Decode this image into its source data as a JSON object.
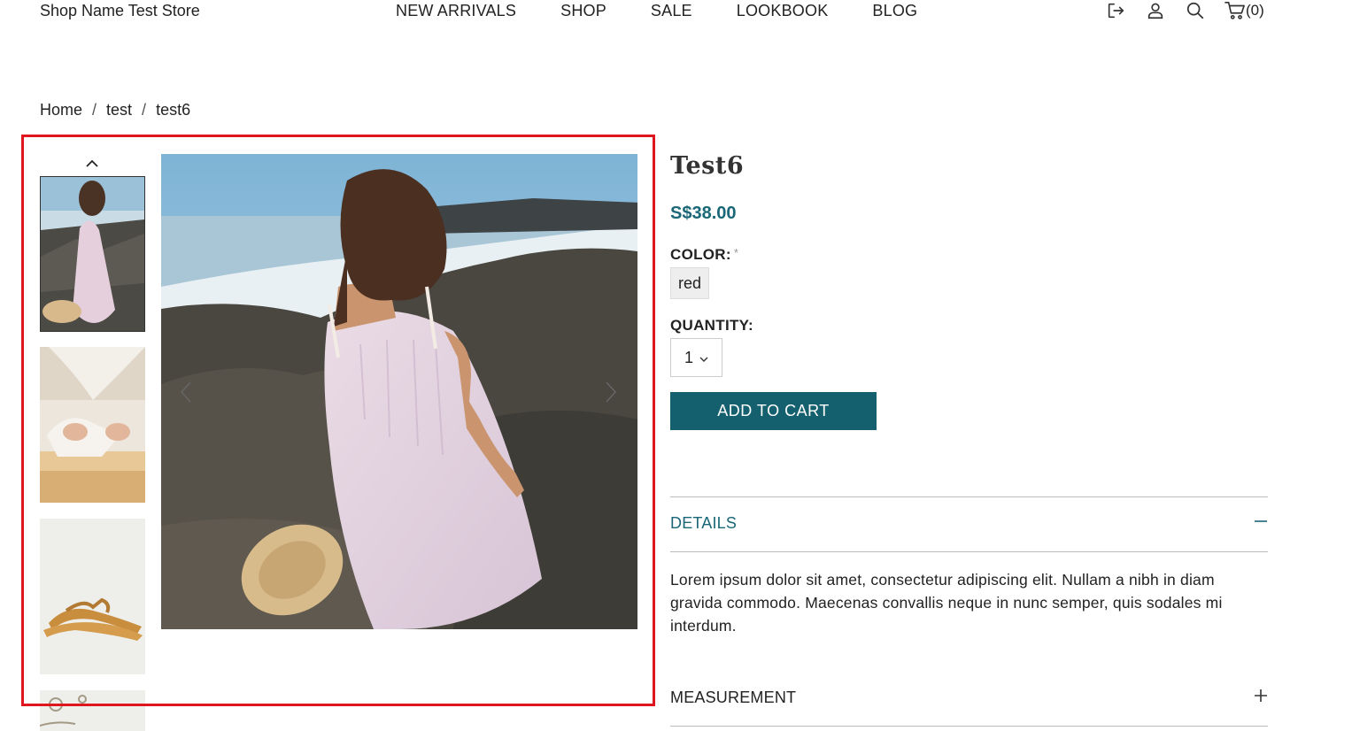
{
  "header": {
    "store_name": "Shop Name Test Store",
    "nav": [
      "NEW ARRIVALS",
      "SHOP",
      "SALE",
      "LOOKBOOK",
      "BLOG"
    ],
    "cart_count": "(0)",
    "icons": [
      "logout-icon",
      "user-icon",
      "search-icon",
      "cart-icon"
    ]
  },
  "breadcrumb": {
    "items": [
      "Home",
      "test",
      "test6"
    ],
    "separator": "/"
  },
  "product": {
    "title": "Test6",
    "price": "S$38.00",
    "color_label": "COLOR:",
    "required_mark": "*",
    "color_value": "red",
    "quantity_label": "QUANTITY:",
    "quantity_value": "1",
    "add_to_cart": "ADD TO CART"
  },
  "accordion": {
    "details_title": "DETAILS",
    "details_toggle": "−",
    "details_body": "Lorem ipsum dolor sit amet, consectetur adipiscing elit. Nullam a nibh in diam gravida commodo. Maecenas convallis neque in nunc semper, quis sodales mi interdum.",
    "measurement_title": "MEASUREMENT",
    "measurement_toggle": "+"
  },
  "colors": {
    "accent": "#1a6777",
    "button": "#15606f",
    "highlight": "#e0161f"
  }
}
